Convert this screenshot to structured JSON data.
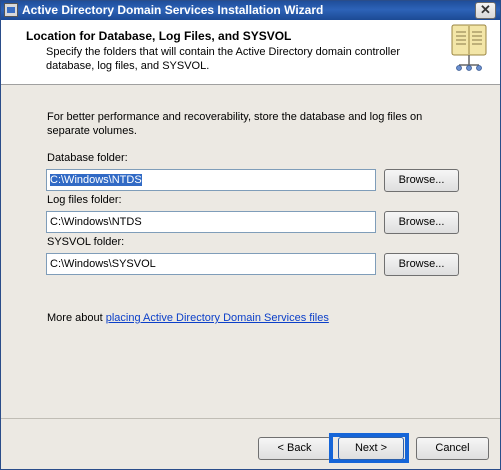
{
  "window": {
    "title": "Active Directory Domain Services Installation Wizard",
    "close_glyph": "✕"
  },
  "header": {
    "title": "Location for Database, Log Files, and SYSVOL",
    "description": "Specify the folders that will contain the Active Directory domain controller database, log files, and SYSVOL."
  },
  "body": {
    "intro": "For better performance and recoverability, store the database and log files on separate volumes.",
    "fields": [
      {
        "label": "Database folder:",
        "value": "C:\\Windows\\NTDS",
        "selected": true,
        "browse_label": "Browse..."
      },
      {
        "label": "Log files folder:",
        "value": "C:\\Windows\\NTDS",
        "selected": false,
        "browse_label": "Browse..."
      },
      {
        "label": "SYSVOL folder:",
        "value": "C:\\Windows\\SYSVOL",
        "selected": false,
        "browse_label": "Browse..."
      }
    ],
    "more_about_prefix": "More about ",
    "more_about_link": "placing Active Directory Domain Services files"
  },
  "footer": {
    "back_label": "< Back",
    "next_label": "Next >",
    "cancel_label": "Cancel"
  },
  "colors": {
    "titlebar": "#1f4e9a",
    "link": "#0b3fc9",
    "highlight": "#1565d8",
    "selection": "#316ac5"
  }
}
